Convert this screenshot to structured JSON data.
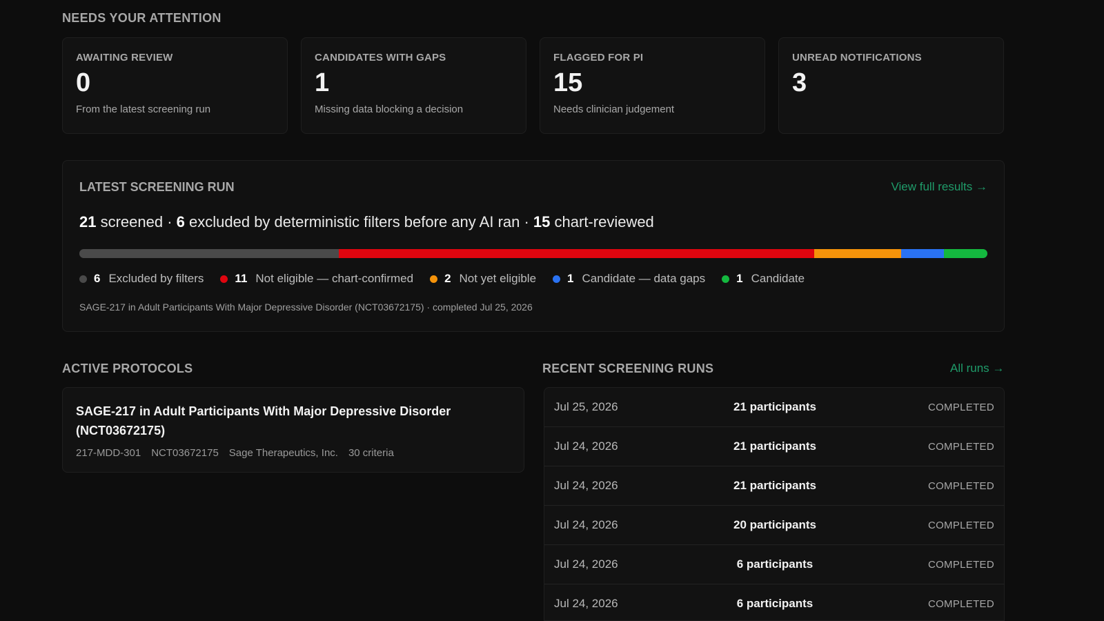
{
  "attention": {
    "title": "NEEDS YOUR ATTENTION",
    "cards": [
      {
        "label": "AWAITING REVIEW",
        "value": "0",
        "sub": "From the latest screening run"
      },
      {
        "label": "CANDIDATES WITH GAPS",
        "value": "1",
        "sub": "Missing data blocking a decision"
      },
      {
        "label": "FLAGGED FOR PI",
        "value": "15",
        "sub": "Needs clinician judgement"
      },
      {
        "label": "UNREAD NOTIFICATIONS",
        "value": "3",
        "sub": ""
      }
    ]
  },
  "latest_run": {
    "title": "LATEST SCREENING RUN",
    "link": "View full results →",
    "summary": {
      "screened_count": "21",
      "screened_text": " screened · ",
      "excluded_count": "6",
      "excluded_text": " excluded by deterministic filters before any AI ran · ",
      "reviewed_count": "15",
      "reviewed_text": " chart-reviewed"
    },
    "breakdown": [
      {
        "count": "6",
        "label": "Excluded by filters",
        "value": 6,
        "color": "#4a4a4a"
      },
      {
        "count": "11",
        "label": "Not eligible — chart-confirmed",
        "value": 11,
        "color": "#e0050f"
      },
      {
        "count": "2",
        "label": "Not yet eligible",
        "value": 2,
        "color": "#f5930a"
      },
      {
        "count": "1",
        "label": "Candidate — data gaps",
        "value": 1,
        "color": "#2a72f2"
      },
      {
        "count": "1",
        "label": "Candidate",
        "value": 1,
        "color": "#14b83f"
      }
    ],
    "meta": "SAGE-217 in Adult Participants With Major Depressive Disorder (NCT03672175) · completed Jul 25, 2026"
  },
  "protocols": {
    "title": "ACTIVE PROTOCOLS",
    "items": [
      {
        "name": "SAGE-217 in Adult Participants With Major Depressive Disorder (NCT03672175)",
        "code": "217-MDD-301",
        "nct": "NCT03672175",
        "sponsor": "Sage Therapeutics, Inc.",
        "criteria": "30 criteria"
      }
    ]
  },
  "recent_runs": {
    "title": "RECENT SCREENING RUNS",
    "link": "All runs →",
    "rows": [
      {
        "date": "Jul 25, 2026",
        "participants": "21 participants",
        "status": "COMPLETED"
      },
      {
        "date": "Jul 24, 2026",
        "participants": "21 participants",
        "status": "COMPLETED"
      },
      {
        "date": "Jul 24, 2026",
        "participants": "21 participants",
        "status": "COMPLETED"
      },
      {
        "date": "Jul 24, 2026",
        "participants": "20 participants",
        "status": "COMPLETED"
      },
      {
        "date": "Jul 24, 2026",
        "participants": "6 participants",
        "status": "COMPLETED"
      },
      {
        "date": "Jul 24, 2026",
        "participants": "6 participants",
        "status": "COMPLETED"
      }
    ]
  }
}
